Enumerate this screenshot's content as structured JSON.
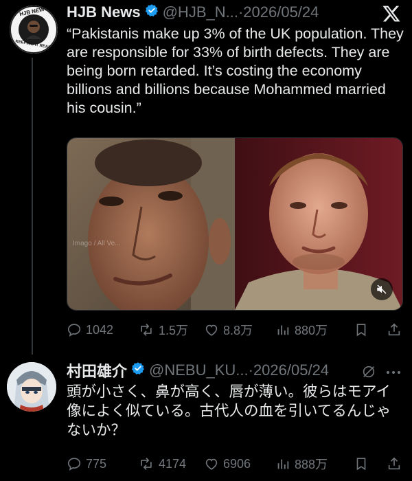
{
  "tweet1": {
    "name": "HJB News",
    "handle": "@HJB_N...",
    "separator": "·",
    "date": "2026/05/24",
    "text": "“Pakistanis make up 3% of the UK population. They are responsible for 33% of birth defects. They are being born retarded. It’s costing the economy billions and billions because Mohammed married his cousin.”",
    "avatar_text_top": "HJB NEWS",
    "avatar_text_bottom": "KEEPING IT REAL",
    "media_watermark": "Imago / All Ve...",
    "stats": {
      "replies": "1042",
      "reposts": "1.5万",
      "likes": "8.8万",
      "views": "880万"
    }
  },
  "tweet2": {
    "name": "村田雄介",
    "handle": "@NEBU_KU...",
    "separator": "·",
    "date": "2026/05/24",
    "text": "頭が小さく、鼻が高く、唇が薄い。彼らはモアイ像によく似ている。古代人の血を引いてるんじゃないか？",
    "stats": {
      "replies": "775",
      "reposts": "4174",
      "likes": "6906",
      "views": "888万"
    }
  },
  "colors": {
    "background": "#000000",
    "text": "#e7e9ea",
    "secondary": "#71767b",
    "verified": "#1d9bf0",
    "divider": "#333639"
  },
  "icons": [
    "x-logo-icon",
    "verified-badge-icon",
    "reply-icon",
    "repost-icon",
    "like-icon",
    "views-icon",
    "bookmark-icon",
    "share-icon",
    "mute-icon",
    "more-icon",
    "grok-slash-icon"
  ]
}
